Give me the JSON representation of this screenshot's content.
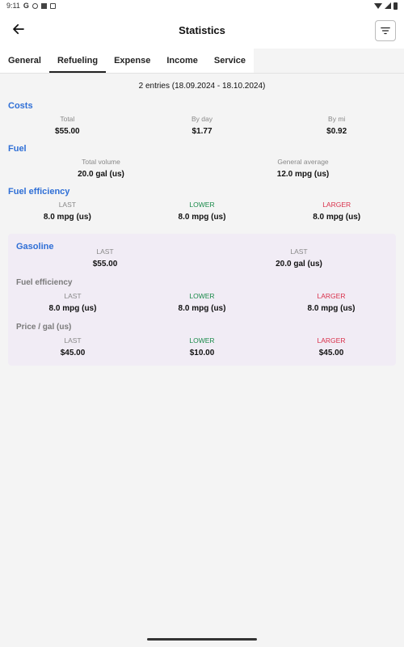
{
  "status_bar": {
    "time": "9:11",
    "icons_left": [
      "google-icon",
      "shield-icon",
      "sim-icon",
      "notification-icon"
    ],
    "icons_right": [
      "wifi-icon",
      "signal-icon",
      "battery-icon"
    ]
  },
  "app_bar": {
    "title": "Statistics",
    "back_icon": "arrow-left-icon",
    "filter_icon": "filter-icon"
  },
  "tabs": [
    {
      "label": "General",
      "active": false
    },
    {
      "label": "Refueling",
      "active": true
    },
    {
      "label": "Expense",
      "active": false
    },
    {
      "label": "Income",
      "active": false
    },
    {
      "label": "Service",
      "active": false
    }
  ],
  "summary": "2 entries (18.09.2024 - 18.10.2024)",
  "costs": {
    "title": "Costs",
    "items": [
      {
        "label": "Total",
        "value": "$55.00"
      },
      {
        "label": "By day",
        "value": "$1.77"
      },
      {
        "label": "By mi",
        "value": "$0.92"
      }
    ]
  },
  "fuel": {
    "title": "Fuel",
    "items": [
      {
        "label": "Total volume",
        "value": "20.0 gal (us)"
      },
      {
        "label": "General average",
        "value": "12.0 mpg (us)"
      }
    ]
  },
  "fuel_efficiency": {
    "title": "Fuel efficiency",
    "items": [
      {
        "label": "LAST",
        "value": "8.0 mpg (us)"
      },
      {
        "label": "LOWER",
        "value": "8.0 mpg (us)"
      },
      {
        "label": "LARGER",
        "value": "8.0 mpg (us)"
      }
    ]
  },
  "gasoline": {
    "title": "Gasoline",
    "items": [
      {
        "label": "LAST",
        "value": "$55.00"
      },
      {
        "label": "LAST",
        "value": "20.0 gal (us)"
      }
    ],
    "fuel_efficiency": {
      "title": "Fuel efficiency",
      "items": [
        {
          "label": "LAST",
          "value": "8.0 mpg (us)"
        },
        {
          "label": "LOWER",
          "value": "8.0 mpg (us)"
        },
        {
          "label": "LARGER",
          "value": "8.0 mpg (us)"
        }
      ]
    },
    "price": {
      "title": "Price / gal (us)",
      "items": [
        {
          "label": "LAST",
          "value": "$45.00"
        },
        {
          "label": "LOWER",
          "value": "$10.00"
        },
        {
          "label": "LARGER",
          "value": "$45.00"
        }
      ]
    }
  },
  "colors": {
    "accent": "#2f6fd6",
    "lower": "#1a8a4a",
    "larger": "#d9304a",
    "card_bg": "#f1ecf5"
  }
}
